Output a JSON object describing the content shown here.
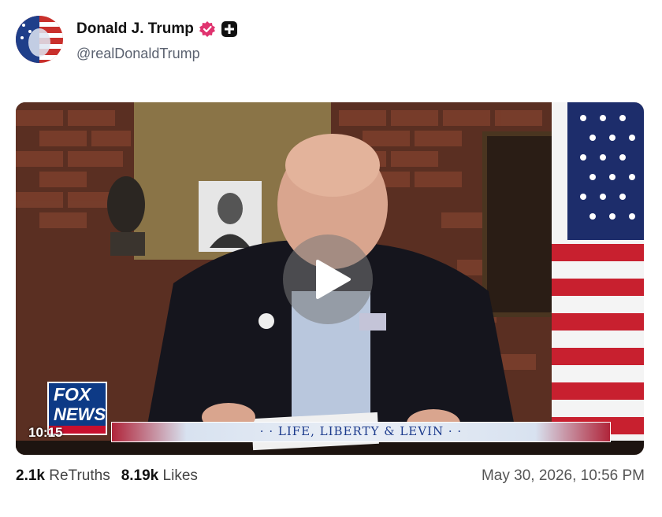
{
  "post": {
    "display_name": "Donald J. Trump",
    "handle": "@realDonaldTrump",
    "badges": [
      "verified-icon",
      "plus-icon"
    ]
  },
  "video": {
    "timestamp": "10:15",
    "logo": {
      "line1": "FOX",
      "line2": "NEWS"
    },
    "chyron": "· · LIFE, LIBERTY & LEVIN · ·",
    "play_icon": "play-icon"
  },
  "stats": {
    "retruths_count": "2.1k",
    "retruths_label": "ReTruths",
    "likes_count": "8.19k",
    "likes_label": "Likes",
    "date": "May 30, 2026, 10:56 PM"
  },
  "colors": {
    "verified": "#e0336f",
    "fox_blue": "#0d3a86",
    "chyron_text": "#1b3a8c"
  }
}
